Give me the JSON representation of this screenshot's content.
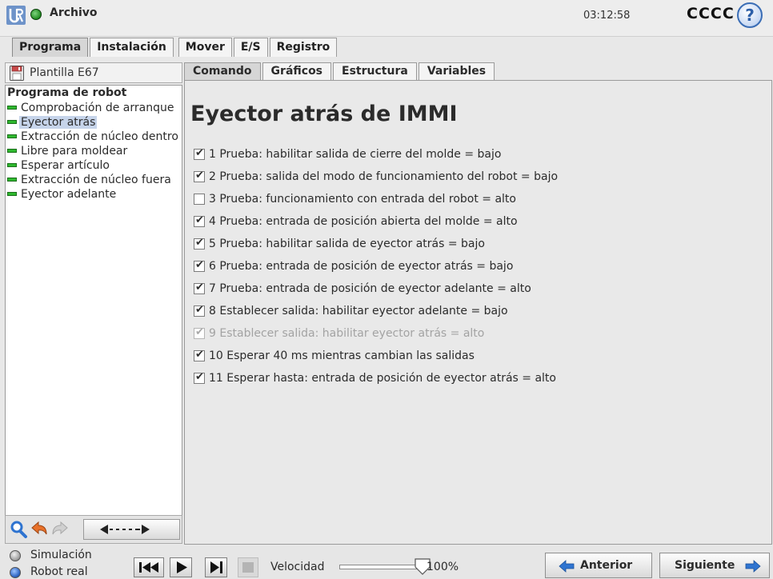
{
  "titlebar": {
    "file_label": "Archivo",
    "clock": "03:12:58",
    "robot_name": "CCCC",
    "help_symbol": "?"
  },
  "top_tabs": [
    "Programa",
    "Instalación",
    "Mover",
    "E/S",
    "Registro"
  ],
  "left": {
    "template_label": "Plantilla E67",
    "tree_root": "Programa de robot",
    "tree_items": [
      "Comprobación de arranque",
      "Eyector atrás",
      "Extracción de núcleo dentro",
      "Libre para moldear",
      "Esperar artículo",
      "Extracción de núcleo fuera",
      "Eyector adelante"
    ],
    "selected_index": 1
  },
  "inner_tabs": [
    "Comando",
    "Gráficos",
    "Estructura",
    "Variables"
  ],
  "content": {
    "title": "Eyector atrás de IMMI",
    "commands": [
      {
        "text": "1 Prueba: habilitar salida de cierre del molde = bajo",
        "checked": true,
        "enabled": true
      },
      {
        "text": "2 Prueba: salida del modo de funcionamiento del robot = bajo",
        "checked": true,
        "enabled": true
      },
      {
        "text": "3 Prueba: funcionamiento con entrada del robot = alto",
        "checked": false,
        "enabled": true
      },
      {
        "text": "4 Prueba: entrada de posición abierta del molde = alto",
        "checked": true,
        "enabled": true
      },
      {
        "text": "5 Prueba: habilitar salida de eyector atrás = bajo",
        "checked": true,
        "enabled": true
      },
      {
        "text": "6 Prueba: entrada de posición de eyector atrás = bajo",
        "checked": true,
        "enabled": true
      },
      {
        "text": "7 Prueba: entrada de posición de eyector adelante = alto",
        "checked": true,
        "enabled": true
      },
      {
        "text": "8 Establecer salida: habilitar eyector adelante = bajo",
        "checked": true,
        "enabled": true
      },
      {
        "text": "9 Establecer salida: habilitar eyector atrás = alto",
        "checked": true,
        "enabled": false
      },
      {
        "text": "10 Esperar 40 ms mientras cambian las salidas",
        "checked": true,
        "enabled": true
      },
      {
        "text": "11 Esperar hasta: entrada de posición de eyector atrás = alto",
        "checked": true,
        "enabled": true
      }
    ]
  },
  "bottom": {
    "simulation_label": "Simulación",
    "real_robot_label": "Robot real",
    "speed_label": "Velocidad",
    "speed_value": "100%",
    "speed_fraction": 1.0,
    "prev_label": "Anterior",
    "next_label": "Siguiente"
  },
  "colors": {
    "status_green": "#2eb82e",
    "selection": "#c6d4ea",
    "accent_blue": "#2e65c2"
  },
  "icons": [
    "ur-logo-icon",
    "status-dot-icon",
    "help-icon",
    "floppy-icon",
    "search-icon",
    "undo-icon",
    "redo-icon",
    "move-arrows-icon",
    "skip-start-icon",
    "play-icon",
    "step-icon",
    "stop-icon",
    "arrow-left-icon",
    "arrow-right-icon"
  ]
}
